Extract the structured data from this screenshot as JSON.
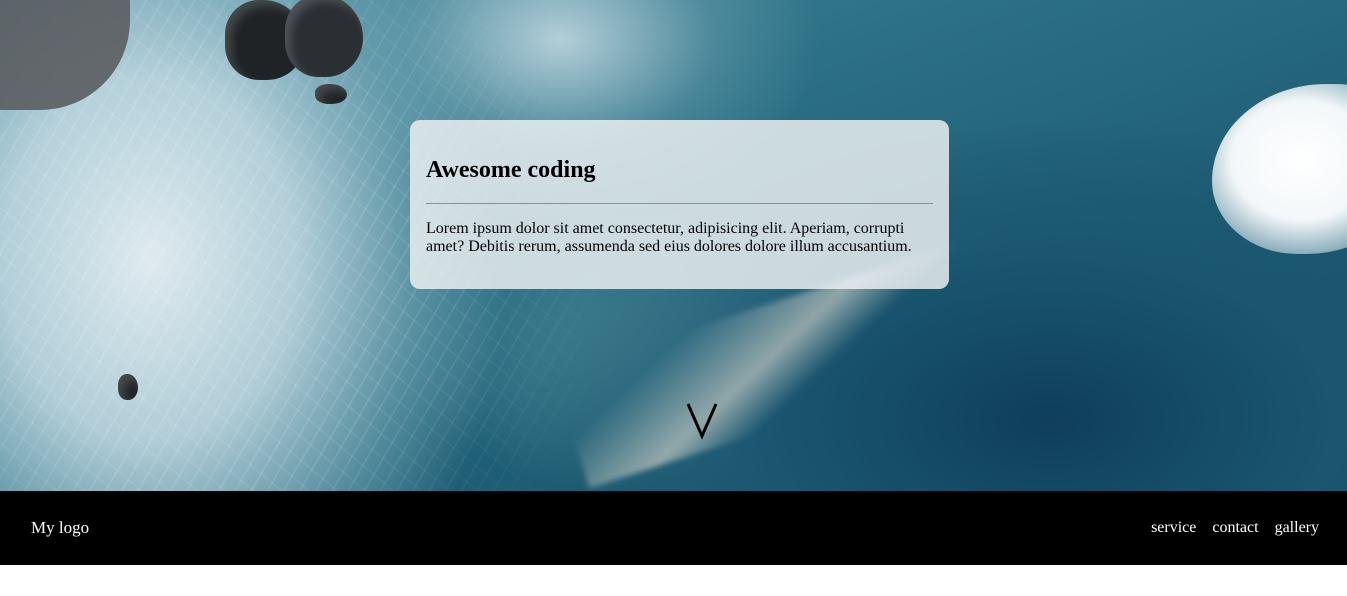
{
  "card": {
    "title": "Awesome coding",
    "body": "Lorem ipsum dolor sit amet consectetur, adipisicing elit. Aperiam, corrupti amet? Debitis rerum, assumenda sed eius dolores dolore illum accusantium."
  },
  "scroll": {
    "icon": "chevron-down-icon"
  },
  "navbar": {
    "logo": "My logo",
    "links": [
      {
        "label": "service"
      },
      {
        "label": "contact"
      },
      {
        "label": "gallery"
      }
    ]
  },
  "colors": {
    "navbar_background": "#000000",
    "navbar_text": "#ffffff",
    "card_background": "#e8eef0",
    "ocean_dark": "#154a62",
    "ocean_light": "#4f8ea0"
  }
}
